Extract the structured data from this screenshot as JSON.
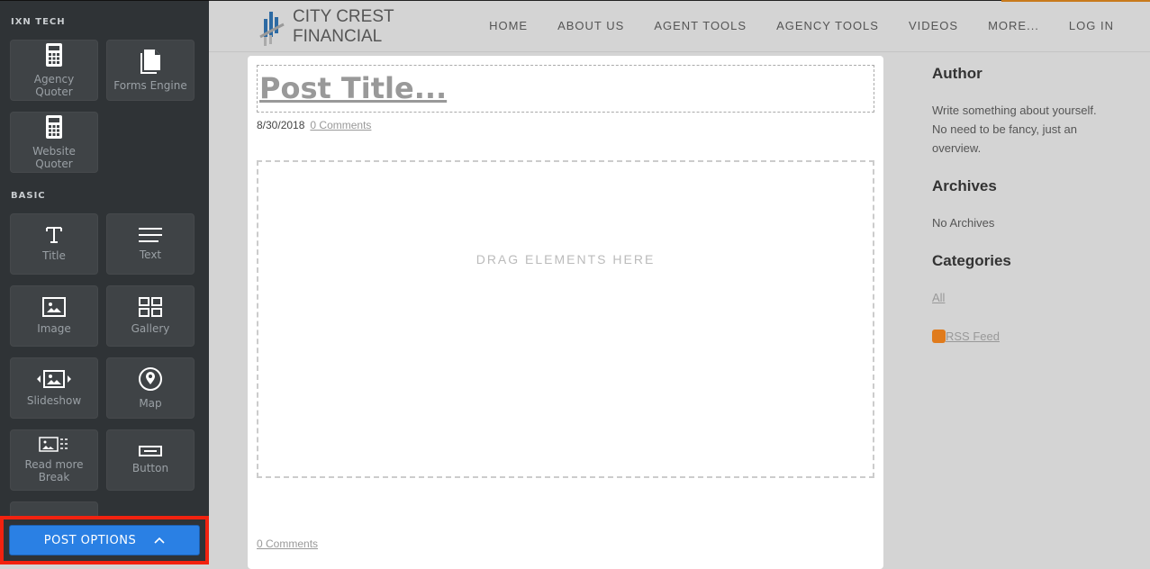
{
  "sidebar": {
    "sections": [
      {
        "label": "IXN TECH"
      },
      {
        "label": "BASIC"
      }
    ],
    "items": [
      {
        "label1": "Agency",
        "label2": "Quoter",
        "icon": "calculator-icon"
      },
      {
        "label1": "Forms Engine",
        "label2": "",
        "icon": "documents-icon"
      },
      {
        "label1": "Website",
        "label2": "Quoter",
        "icon": "calculator-icon"
      },
      {
        "label1": "Title",
        "label2": "",
        "icon": "title-icon"
      },
      {
        "label1": "Text",
        "label2": "",
        "icon": "text-icon"
      },
      {
        "label1": "Image",
        "label2": "",
        "icon": "image-icon"
      },
      {
        "label1": "Gallery",
        "label2": "",
        "icon": "gallery-icon"
      },
      {
        "label1": "Slideshow",
        "label2": "",
        "icon": "slideshow-icon"
      },
      {
        "label1": "Map",
        "label2": "",
        "icon": "map-pin-icon"
      },
      {
        "label1": "Read more",
        "label2": "Break",
        "icon": "read-more-icon"
      },
      {
        "label1": "Button",
        "label2": "",
        "icon": "button-icon"
      }
    ],
    "post_options": "POST OPTIONS"
  },
  "header": {
    "logo_line1": "CITY CREST",
    "logo_line2": "FINANCIAL",
    "nav": [
      "HOME",
      "ABOUT US",
      "AGENT TOOLS",
      "AGENCY TOOLS",
      "VIDEOS",
      "MORE...",
      "LOG IN"
    ]
  },
  "post": {
    "title": "Post Title...",
    "date": "8/30/2018",
    "comments": "0 Comments",
    "drop_hint": "DRAG ELEMENTS HERE",
    "footer_comments": "0 Comments"
  },
  "aside": {
    "author_heading": "Author",
    "author_text": "Write something about yourself. No need to be fancy, just an overview.",
    "archives_heading": "Archives",
    "archives_text": "No Archives",
    "categories_heading": "Categories",
    "all_link": "All",
    "rss": "RSS Feed"
  },
  "colors": {
    "accent": "#2a80e4",
    "highlight": "#f2220f",
    "sidebar": "#2f3336"
  }
}
